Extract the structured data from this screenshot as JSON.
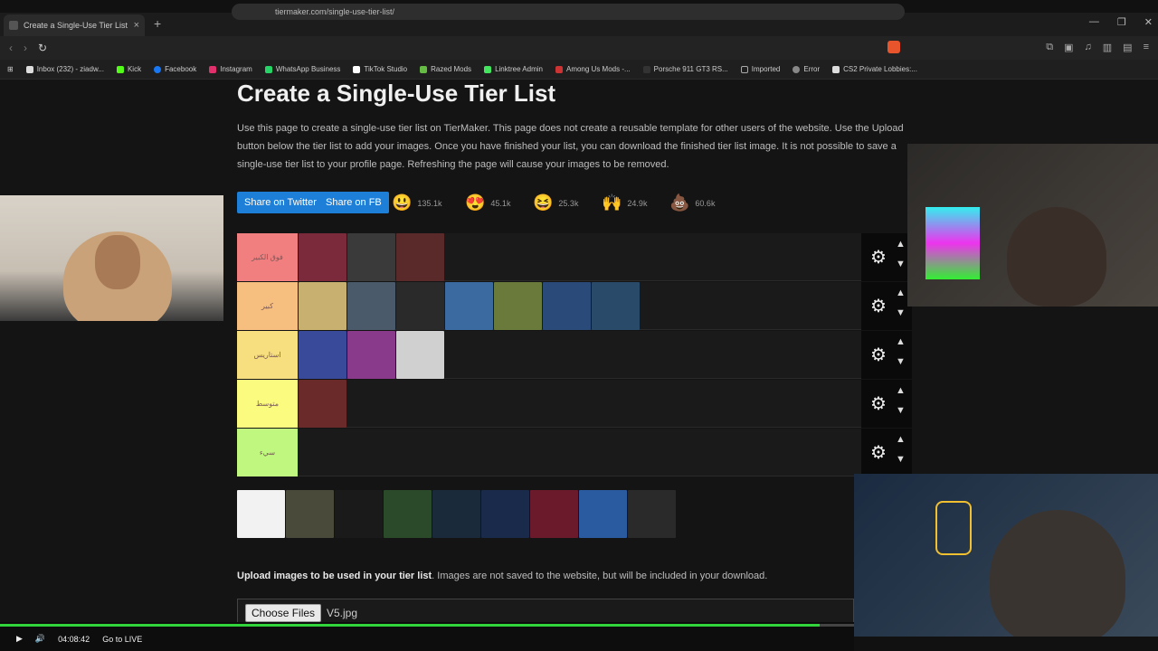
{
  "browser": {
    "tab_title": "Create a Single-Use Tier List (Pr",
    "url": "tiermaker.com/single-use-tier-list/",
    "bookmarks": [
      "Inbox (232) - ziadw...",
      "Kick",
      "Facebook",
      "Instagram",
      "WhatsApp Business",
      "TikTok Studio",
      "Razed Mods",
      "Linktree Admin",
      "Among Us Mods -...",
      "Porsche 911 GT3 RS...",
      "Imported",
      "Error",
      "CS2 Private Lobbies:..."
    ]
  },
  "page": {
    "title": "Create a Single-Use Tier List",
    "description": "Use this page to create a single-use tier list on TierMaker. This page does not create a reusable template for other users of the website. Use the Upload button below the tier list to add your images. Once you have finished your list, you can download the finished tier list image. It is not possible to save a single-use tier list to your profile page. Refreshing the page will cause your images to be removed.",
    "share_twitter": "Share on Twitter",
    "share_fb": "Share on FB",
    "reactions": [
      {
        "icon": "grin-emoji",
        "glyph": "😃",
        "count": "135.1k"
      },
      {
        "icon": "heart-eyes-emoji",
        "glyph": "😍",
        "count": "45.1k"
      },
      {
        "icon": "laugh-emoji",
        "glyph": "😆",
        "count": "25.3k"
      },
      {
        "icon": "raised-hands-emoji",
        "glyph": "🙌",
        "count": "24.9k"
      },
      {
        "icon": "poop-emoji",
        "glyph": "💩",
        "count": "60.6k"
      }
    ],
    "tiers": [
      {
        "label": "فوق الكبير",
        "color": "#f27f7f",
        "items": 3
      },
      {
        "label": "كبير",
        "color": "#f7bf7f",
        "items": 7
      },
      {
        "label": "استاريس",
        "color": "#f7df7f",
        "items": 3
      },
      {
        "label": "متوسط",
        "color": "#fbfb7f",
        "items": 1
      },
      {
        "label": "سيء",
        "color": "#bff77f",
        "items": 0
      }
    ],
    "pool_count": 9,
    "upload_label_bold": "Upload images to be used in your tier list",
    "upload_label_rest": ". Images are not saved to the website, but will be included in your download.",
    "choose_files": "Choose Files",
    "file_name": "V5.jpg"
  },
  "player": {
    "time": "04:08:42",
    "live": "Go to LIVE",
    "progress": 0.96
  }
}
